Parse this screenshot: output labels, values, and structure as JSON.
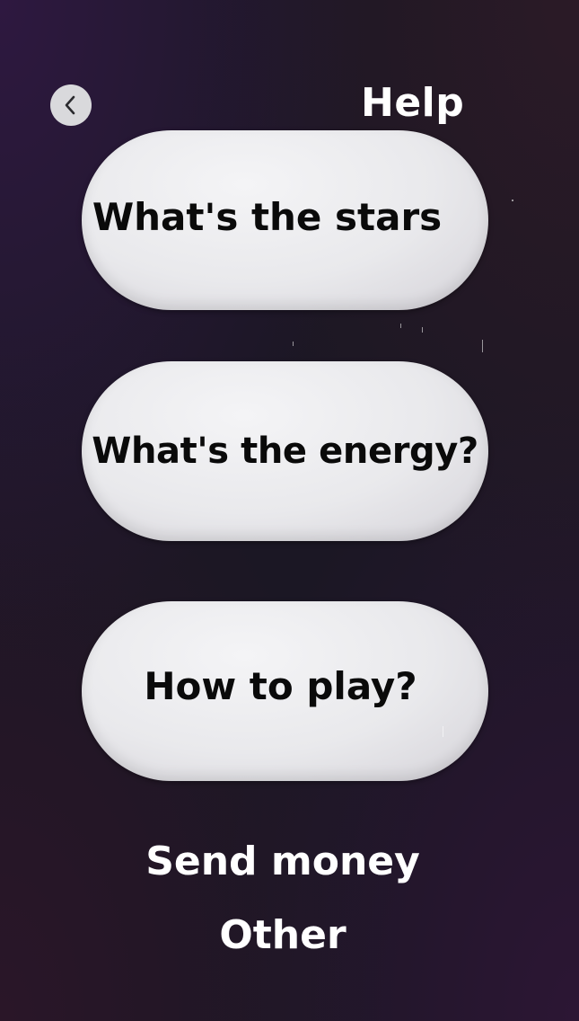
{
  "header": {
    "title": "Help",
    "back_icon": "chevron-left-icon"
  },
  "menu": {
    "items": [
      {
        "label": "What's the stars"
      },
      {
        "label": "What's the energy?"
      },
      {
        "label": "How to play?"
      }
    ]
  },
  "links": {
    "send_money": "Send money",
    "other": "Other"
  },
  "colors": {
    "background": "#1b1724",
    "pill": "#e9e9ec",
    "pill_text": "#0a0a0a",
    "title_text": "#ffffff"
  }
}
